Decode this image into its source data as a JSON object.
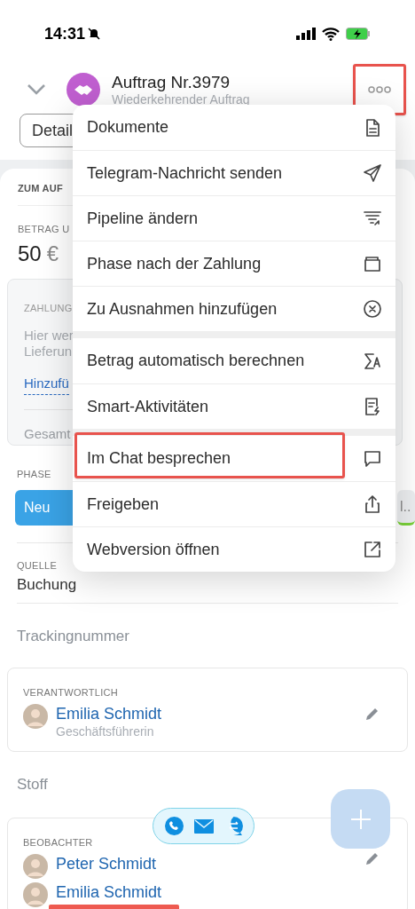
{
  "status_bar": {
    "time": "14:31"
  },
  "header": {
    "title": "Auftrag Nr.3979",
    "subtitle": "Wiederkehrender Auftrag",
    "more_highlighted": true
  },
  "tab": {
    "label": "Detail"
  },
  "order": {
    "label": "ZUM AUF",
    "amount_label": "BETRAG U",
    "amount": "50",
    "currency": "€"
  },
  "payments": {
    "label": "ZAHLUNG",
    "hint_lines": [
      "Hier wer",
      "Lieferun"
    ],
    "add_link": "Hinzufü",
    "total_label": "Gesamt"
  },
  "phase": {
    "label": "PHASE",
    "stages": [
      {
        "label": "Neu",
        "selected": true
      },
      {
        "label": "l..",
        "selected": false
      }
    ]
  },
  "source": {
    "label": "QUELLE",
    "value": "Buchung"
  },
  "tracking": {
    "placeholder": "Trackingnummer"
  },
  "responsible": {
    "label": "VERANTWORTLICH",
    "people": [
      {
        "name": "Emilia Schmidt",
        "role": "Geschäftsführerin"
      }
    ]
  },
  "material": {
    "placeholder": "Stoff"
  },
  "observers": {
    "label": "BEOBACHTER",
    "people": [
      {
        "name": "Peter Schmidt"
      },
      {
        "name": "Emilia Schmidt"
      }
    ]
  },
  "menu": [
    [
      {
        "label": "Dokumente",
        "highlighted": false
      },
      {
        "label": "Telegram-Nachricht senden",
        "highlighted": false
      },
      {
        "label": "Pipeline ändern",
        "highlighted": false
      },
      {
        "label": "Phase nach der Zahlung",
        "highlighted": false
      },
      {
        "label": "Zu Ausnahmen hinzufügen",
        "highlighted": false
      }
    ],
    [
      {
        "label": "Betrag automatisch berechnen",
        "highlighted": false
      },
      {
        "label": "Smart-Aktivitäten",
        "highlighted": false
      }
    ],
    [
      {
        "label": "Im Chat besprechen",
        "highlighted": true
      },
      {
        "label": "Freigeben",
        "highlighted": false
      },
      {
        "label": "Webversion öffnen",
        "highlighted": false
      }
    ]
  ]
}
